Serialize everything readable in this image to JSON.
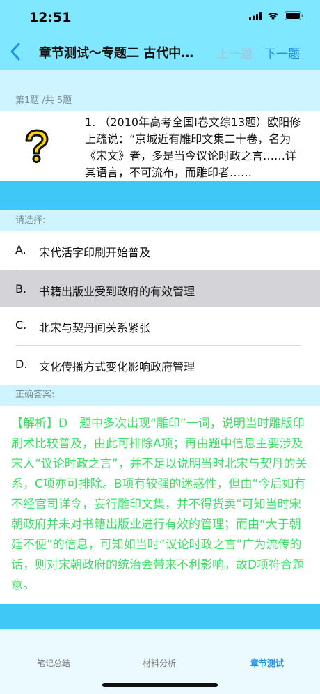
{
  "status_bar": {
    "time": "12:51"
  },
  "nav": {
    "title": "章节测试～专题二 古代中国的科技与文化",
    "prev_label": "上一题",
    "next_label": "下一题"
  },
  "question": {
    "counter": "第1题 /共 5题",
    "text": "1. （2010年高考全国Ⅰ卷文综13题）欧阳修上疏说：“京城近有雕印文集二十卷，名为《宋文》者，多是当今议论时政之言……详其语言，不可流布，而雕印者……"
  },
  "options_header": "请选择:",
  "options": [
    {
      "letter": "A.",
      "text": "宋代活字印刷开始普及"
    },
    {
      "letter": "B.",
      "text": "书籍出版业受到政府的有效管理"
    },
    {
      "letter": "C.",
      "text": "北宋与契丹间关系紧张"
    },
    {
      "letter": "D.",
      "text": "文化传播方式变化影响政府管理"
    }
  ],
  "answer_header": "正确答案:",
  "answer_text": "【解析】D　题中多次出现“雕印”一词，说明当时雕版印刷术比较普及，由此可排除A项；再由题中信息主要涉及宋人“议论时政之言”，并不足以说明当时北宋与契丹的关系，C项亦可排除。B项有较强的迷惑性，但由“今后如有不经官司详令，妄行雕印文集，并不得货卖”可知当时宋朝政府并未对书籍出版业进行有效的管理；而由“大于朝廷不便”的信息，可知如当时“议论时政之言”广为流传的话，则对宋朝政府的统治会带来不利影响。故D项符合题意。",
  "tabs": [
    {
      "label": "笔记总结",
      "active": false
    },
    {
      "label": "材料分析",
      "active": false
    },
    {
      "label": "章节测试",
      "active": true
    }
  ],
  "colors": {
    "nav_background": "#7fe7ff",
    "section_header": "#cdf4ff",
    "blue_band": "#3fc8f6",
    "selected_option": "#d4d4d8",
    "answer_text": "#3ce065",
    "link_blue": "#1d8ee8"
  },
  "icons": [
    "back-chevron-icon",
    "question-mark-icon",
    "signal-icon",
    "wifi-icon",
    "battery-icon"
  ]
}
